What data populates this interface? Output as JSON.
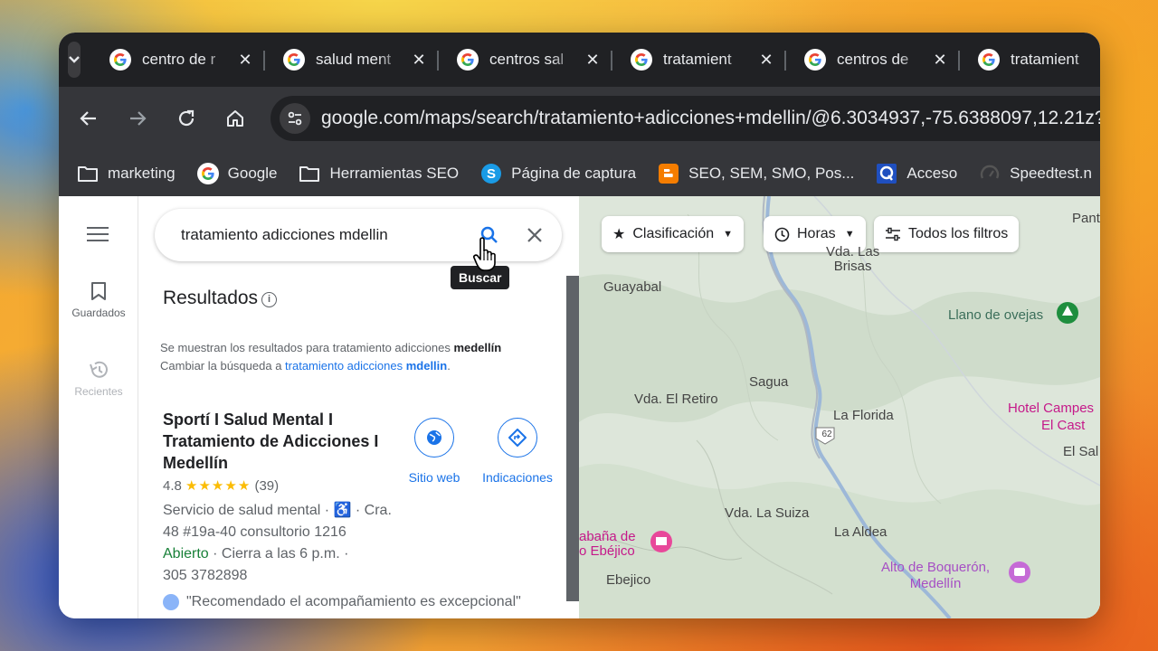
{
  "browser": {
    "tabs": [
      {
        "title": "centro de r"
      },
      {
        "title": "salud ment"
      },
      {
        "title": "centros sal"
      },
      {
        "title": "tratamient"
      },
      {
        "title": "centros de"
      },
      {
        "title": "tratamient"
      }
    ],
    "url": "google.com/maps/search/tratamiento+adicciones+mdellin/@6.3034937,-75.6388097,12.21z?",
    "bookmarks": [
      {
        "label": "marketing",
        "icon": "folder-icon"
      },
      {
        "label": "Google",
        "icon": "google-icon"
      },
      {
        "label": "Herramientas SEO",
        "icon": "folder-icon"
      },
      {
        "label": "Página de captura",
        "icon": "s-icon"
      },
      {
        "label": "SEO, SEM, SMO, Pos...",
        "icon": "blogger-icon"
      },
      {
        "label": "Acceso",
        "icon": "q-icon"
      },
      {
        "label": "Speedtest.n",
        "icon": "speedtest-icon"
      }
    ]
  },
  "rail": {
    "saved": "Guardados",
    "recent": "Recientes"
  },
  "search": {
    "query": "tratamiento adicciones mdellin",
    "tooltip": "Buscar"
  },
  "results": {
    "title": "Resultados",
    "showing_prefix": "Se muestran los resultados para tratamiento adicciones ",
    "showing_bold": "medellín",
    "change_prefix": "Cambiar la búsqueda a ",
    "change_link": "tratamiento adicciones ",
    "change_link_bold": "mdellin",
    "change_suffix": "."
  },
  "listing": {
    "name": "Sportí I Salud Mental I Tratamiento de Adicciones I Medellín",
    "rating": "4.8",
    "stars": "★★★★★",
    "reviews": "(39)",
    "category": "Servicio de salud mental · ",
    "address": " · Cra. 48 #19a-40 consultorio 1216",
    "status": "Abierto",
    "hours": " · Cierra a las 6 p.m. · ",
    "phone": "305 3782898",
    "website_label": "Sitio web",
    "directions_label": "Indicaciones",
    "review": "\"Recomendado el acompañamiento es excepcional\""
  },
  "map": {
    "filters": [
      {
        "label": "Clasificación",
        "icon": "star-icon"
      },
      {
        "label": "Horas",
        "icon": "clock-icon"
      },
      {
        "label": "Todos los filtros",
        "icon": "sliders-icon"
      }
    ],
    "labels": {
      "pant": "Pant",
      "brisas": "Vda. Las\nBrisas",
      "guayabal": "Guayabal",
      "llano": "Llano de ovejas",
      "sagua": "Sagua",
      "retiro": "Vda. El Retiro",
      "hotel": "Hotel Campes",
      "elcast": "El Cast",
      "laflorida": "La Florida",
      "elsal": "El Sal",
      "route": "62",
      "suiza": "Vda. La Suiza",
      "aldea": "La Aldea",
      "cabana": "abaña de\no Ebéjico",
      "ebejico": "Ebejico",
      "boqueron": "Alto de Boquerón,\nMedellín"
    }
  }
}
